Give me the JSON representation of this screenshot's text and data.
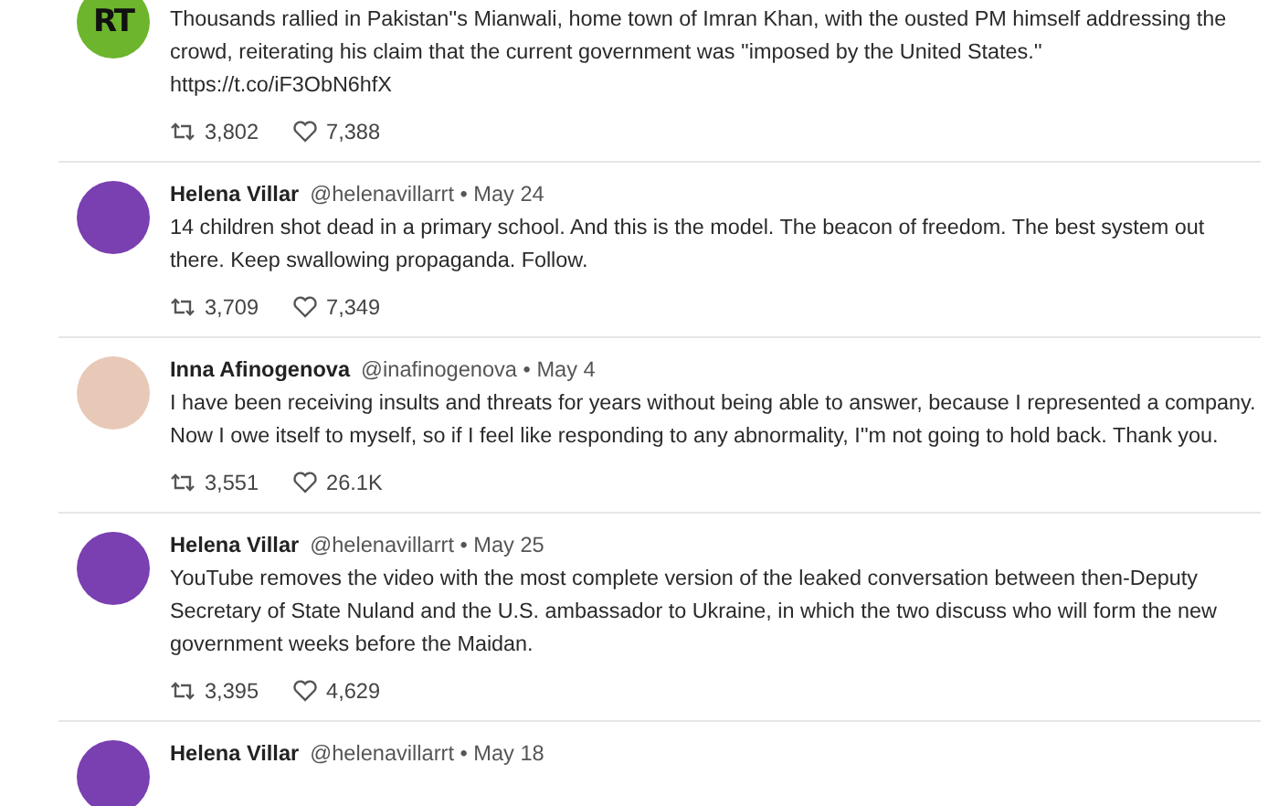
{
  "posts": [
    {
      "avatar": {
        "kind": "logo",
        "text": "RT",
        "color": "#6cb52d"
      },
      "text": "Thousands rallied in Pakistan''s Mianwali, home town of Imran Khan, with the ousted PM himself addressing the crowd, reiterating his claim that the current government was ''imposed by the United States.'' https://t.co/iF3ObN6hfX",
      "retweets": "3,802",
      "likes": "7,388"
    },
    {
      "avatar": {
        "kind": "photo",
        "color": "#7a3fb0"
      },
      "name": "Helena Villar",
      "handle": "@helenavillarrt",
      "separator": "•",
      "date": "May 24",
      "text": "14 children shot dead in a primary school. And this is the model. The beacon of freedom. The best system out there. Keep swallowing propaganda. Follow.",
      "retweets": "3,709",
      "likes": "7,349"
    },
    {
      "avatar": {
        "kind": "photo",
        "color": "#e8c9b8"
      },
      "name": "Inna Afinogenova",
      "handle": "@inafinogenova",
      "separator": "•",
      "date": "May 4",
      "text": "I have been receiving insults and threats for years without being able to answer, because I represented a company. Now I owe itself to myself, so if I feel like responding to any abnormality, I''m not going to hold back. Thank you.",
      "retweets": "3,551",
      "likes": "26.1K"
    },
    {
      "avatar": {
        "kind": "photo",
        "color": "#7a3fb0"
      },
      "name": "Helena Villar",
      "handle": "@helenavillarrt",
      "separator": "•",
      "date": "May 25",
      "text": "YouTube removes the video with the most complete version of the leaked conversation between then-Deputy Secretary of State Nuland and the U.S. ambassador to Ukraine, in which the two discuss who will form the new government weeks before the Maidan.",
      "retweets": "3,395",
      "likes": "4,629"
    },
    {
      "avatar": {
        "kind": "photo",
        "color": "#7a3fb0"
      },
      "name": "Helena Villar",
      "handle": "@helenavillarrt",
      "separator": "•",
      "date": "May 18"
    }
  ]
}
